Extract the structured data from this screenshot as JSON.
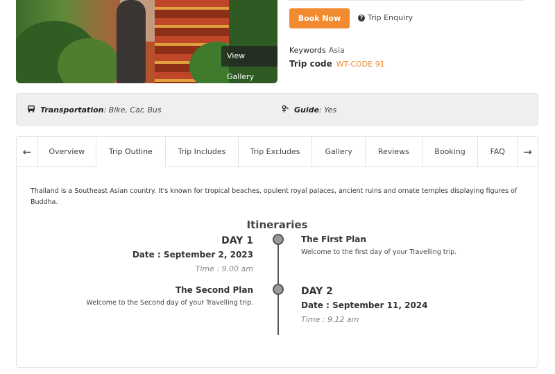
{
  "gallery": {
    "view_label": "View Gallery"
  },
  "actions": {
    "book_label": "Book Now",
    "enquiry_label": "Trip Enquiry"
  },
  "meta": {
    "keywords_label": "Keywords",
    "keywords_value": "Asia",
    "trip_code_label": "Trip code",
    "trip_code_value": "WT-CODE 91"
  },
  "facts": {
    "transport_label": "Transportation",
    "transport_value": ": Bike, Car, Bus",
    "guide_label": "Guide",
    "guide_value": ": Yes"
  },
  "tabs": [
    "Overview",
    "Trip Outline",
    "Trip Includes",
    "Trip Excludes",
    "Gallery",
    "Reviews",
    "Booking",
    "FAQ"
  ],
  "active_tab": "Trip Outline",
  "outline": {
    "description": "Thailand is a Southeast Asian country. It's known for tropical beaches, opulent royal palaces, ancient ruins and ornate temples displaying figures of Buddha.",
    "title": "Itineraries",
    "days": [
      {
        "day": "DAY 1",
        "date": "Date : September 2, 2023",
        "time": "Time : 9.00 am",
        "plan_title": "The First Plan",
        "plan_desc": "Welcome to the first day of your Travelling trip."
      },
      {
        "day": "DAY 2",
        "date": "Date : September 11, 2024",
        "time": "Time : 9.12 am",
        "plan_title": "The Second Plan",
        "plan_desc": "Welcome to the Second day of your Travelling trip."
      }
    ]
  },
  "colors": {
    "accent": "#f28b30",
    "panel_bg": "#efefef"
  }
}
